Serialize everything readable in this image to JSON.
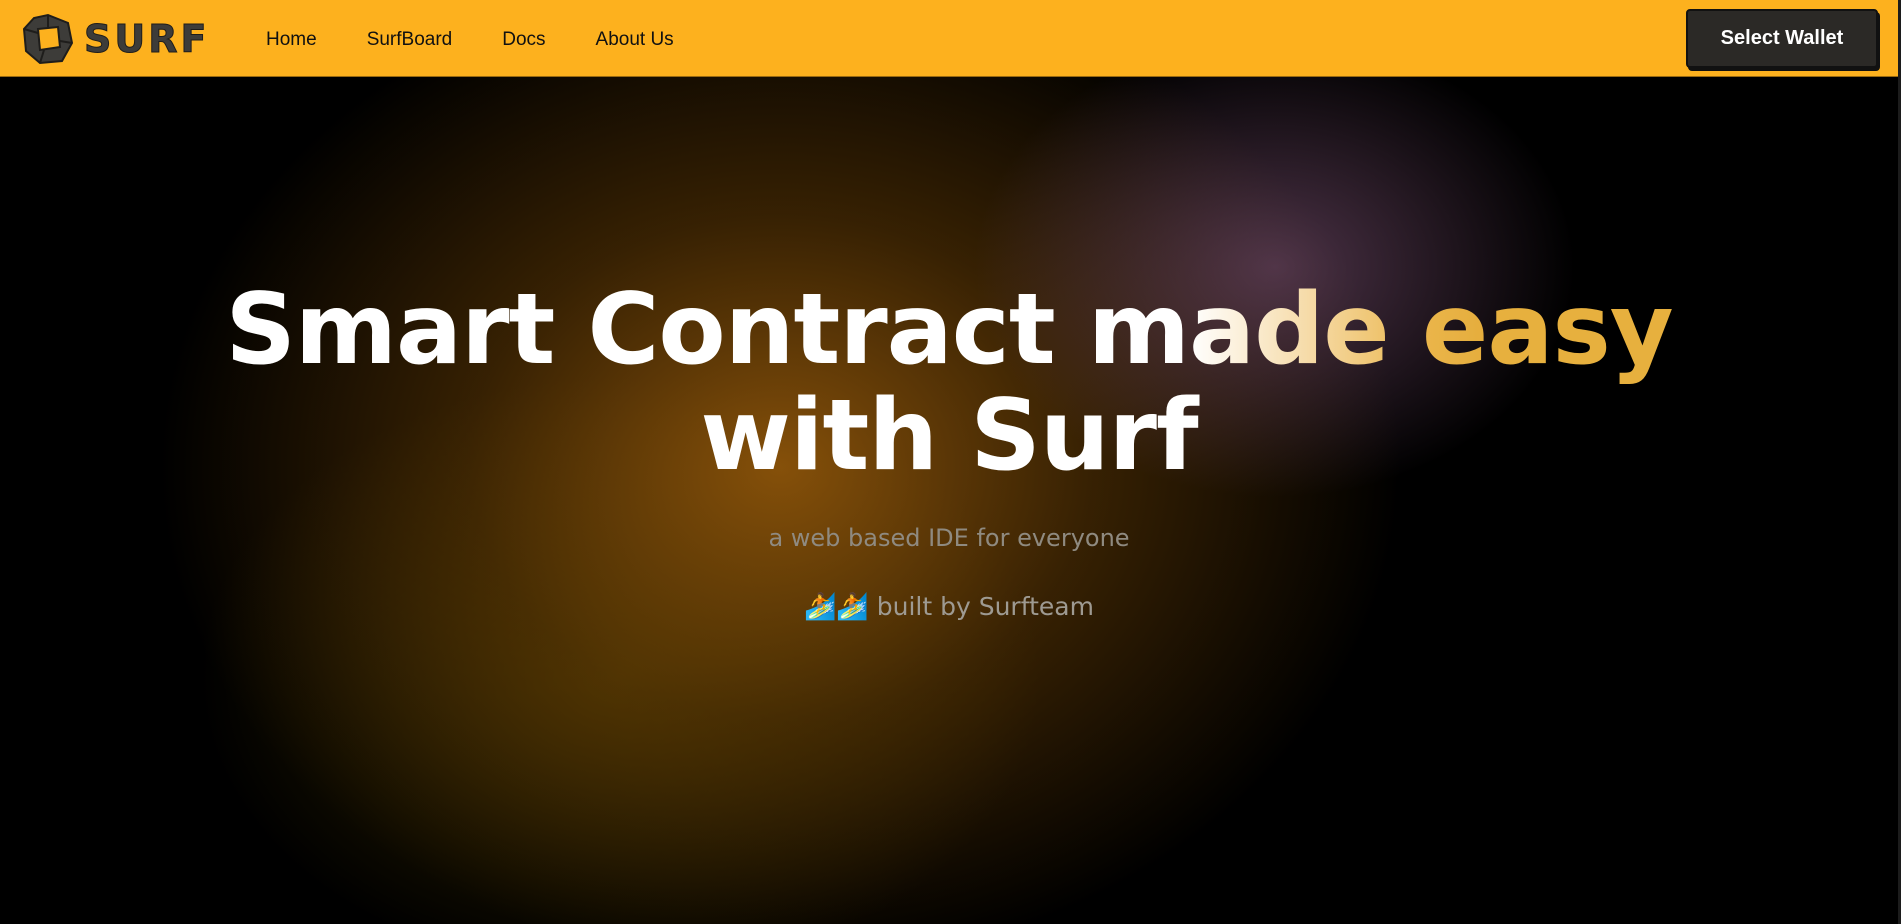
{
  "brand": {
    "name": "SURF",
    "icon": "surf-logo-icon",
    "color": "#3d3c39"
  },
  "nav": {
    "background": "#fdb11e",
    "links": [
      {
        "label": "Home"
      },
      {
        "label": "SurfBoard"
      },
      {
        "label": "Docs"
      },
      {
        "label": "About Us"
      }
    ],
    "wallet_button": "Select Wallet"
  },
  "hero": {
    "headline_part1": "Smart Contract m",
    "headline_part2": "ade e",
    "headline_part3": "asy",
    "headline_line2": "with Surf",
    "subtitle": "a web based IDE for everyone",
    "built_emoji": "🏄🏄",
    "built_by": "built by Surfteam",
    "accent_color": "#e7b03e"
  }
}
